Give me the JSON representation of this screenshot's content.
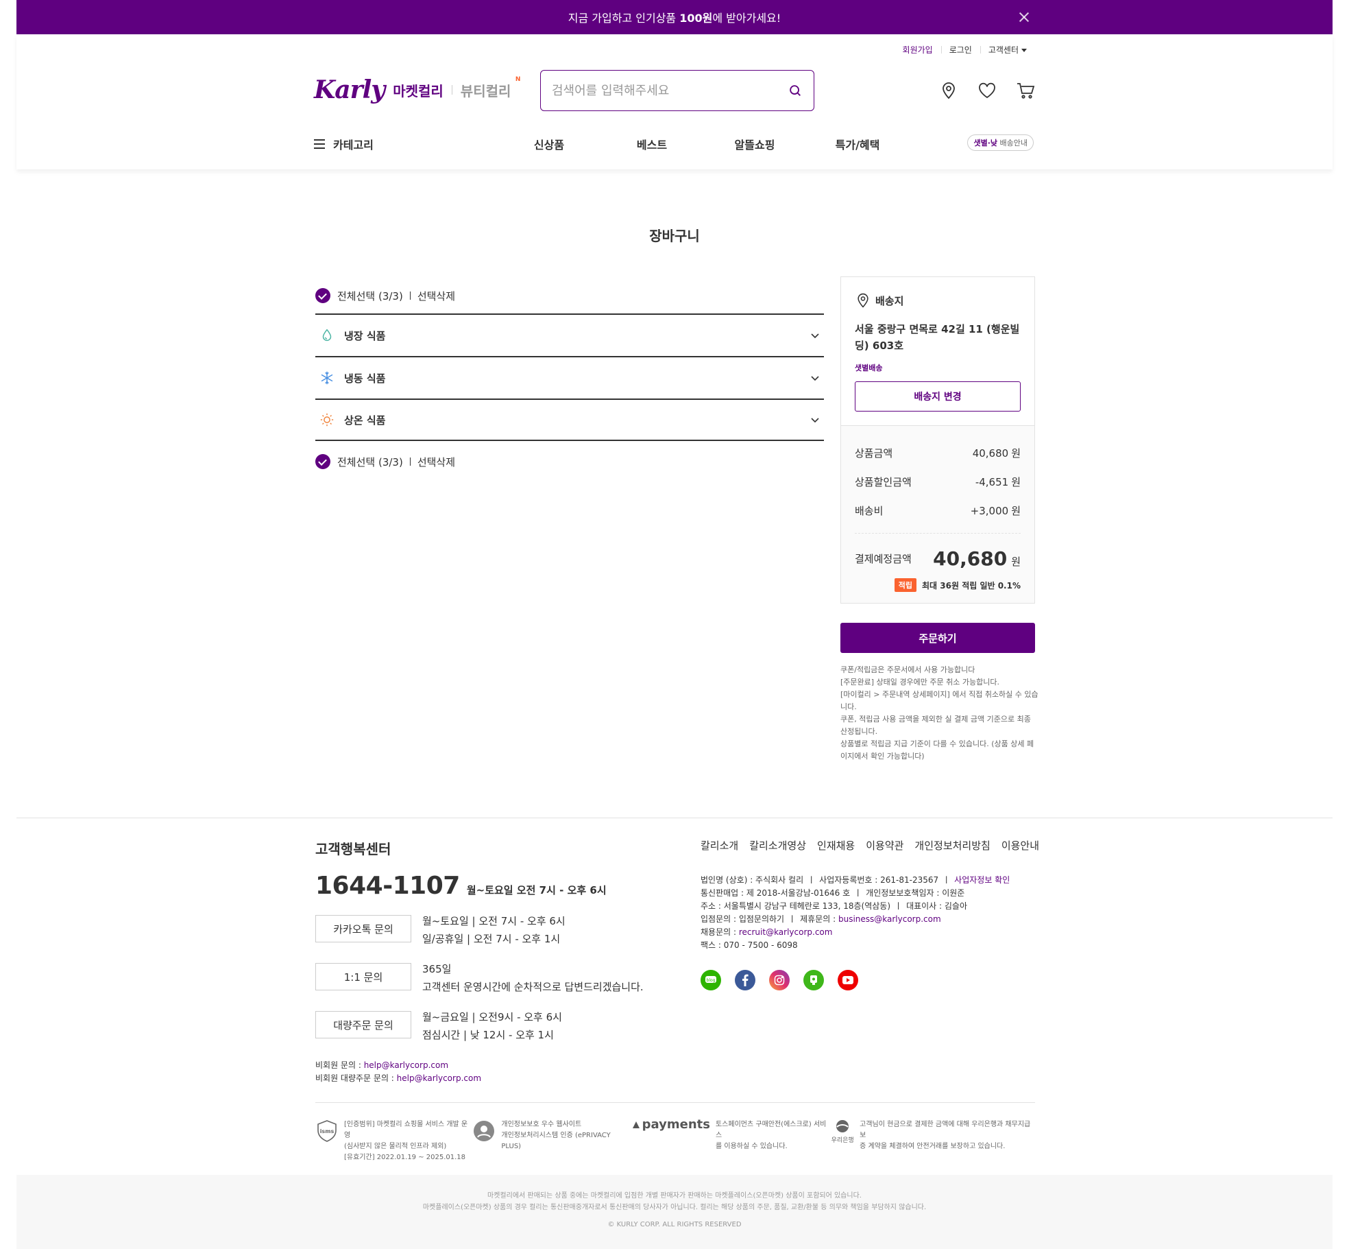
{
  "banner": {
    "text_pre": "지금 가입하고 인기상품 ",
    "text_bold": "100원",
    "text_post": "에 받아가세요!"
  },
  "util": {
    "signup": "회원가입",
    "login": "로그인",
    "support": "고객센터"
  },
  "logo": {
    "karly": "Karly",
    "market": "마켓컬리",
    "beauty": "뷰티컬리",
    "new": "N"
  },
  "search": {
    "placeholder": "검색어를 입력해주세요"
  },
  "gnb": {
    "category": "카테고리",
    "menu": [
      "신상품",
      "베스트",
      "알뜰쇼핑",
      "특가/혜택"
    ],
    "delivery_badge_bold": "샛별·낮",
    "delivery_badge_text": "배송안내"
  },
  "page_title": "장바구니",
  "cart": {
    "select_all": "전체선택 (3/3)",
    "delete_selected": "선택삭제",
    "groups": [
      "냉장 식품",
      "냉동 식품",
      "상온 식품"
    ]
  },
  "address": {
    "title": "배송지",
    "text": "서울 중랑구 면목로 42길 11 (행운빌딩) 603호",
    "type": "샛별배송",
    "change_button": "배송지 변경"
  },
  "price": {
    "rows": [
      {
        "label": "상품금액",
        "value": "40,680",
        "unit": "원"
      },
      {
        "label": "상품할인금액",
        "value": "-4,651",
        "unit": "원"
      },
      {
        "label": "배송비",
        "value": "+3,000",
        "unit": "원"
      }
    ],
    "total_label": "결제예정금액",
    "total_value": "40,680",
    "total_unit": "원",
    "point_tag": "적립",
    "point_text": "최대 36원 적립 일반 0.1%"
  },
  "order_button": "주문하기",
  "notes": [
    "쿠폰/적립금은 주문서에서 사용 가능합니다",
    "[주문완료] 상태일 경우에만 주문 취소 가능합니다.",
    "[마이컬리 > 주문내역 상세페이지] 에서 직접 취소하실 수 있습니다.",
    "쿠폰, 적립금 사용 금액을 제외한 실 결제 금액 기준으로 최종 산정됩니다.",
    "상품별로 적립금 지급 기준이 다를 수 있습니다. (상품 상세 페이지에서 확인 가능합니다)"
  ],
  "footer": {
    "cs_title": "고객행복센터",
    "phone": "1644-1107",
    "phone_hours": "월~토요일 오전 7시 - 오후 6시",
    "channels": [
      {
        "button": "카카오톡 문의",
        "line1": "월~토요일 | 오전 7시 - 오후 6시",
        "line2": "일/공휴일 | 오전 7시 - 오후 1시"
      },
      {
        "button": "1:1 문의",
        "line1": "365일",
        "line2": "고객센터 운영시간에 순차적으로 답변드리겠습니다."
      },
      {
        "button": "대량주문 문의",
        "line1": "월~금요일 | 오전9시 - 오후 6시",
        "line2": "점심시간 | 낮 12시 - 오후 1시"
      }
    ],
    "mail1_label": "비회원 문의 : ",
    "mail1": "help@karlycorp.com",
    "mail2_label": "비회원 대량주문 문의 : ",
    "mail2": "help@karlycorp.com",
    "links": [
      "칼리소개",
      "칼리소개영상",
      "인재채용",
      "이용약관",
      "개인정보처리방침",
      "이용안내"
    ],
    "info": {
      "company": "법인명 (상호) : 주식회사 컬리",
      "biz_no": "사업자등록번호 : 261-81-23567",
      "biz_check": "사업자정보 확인",
      "ecommerce": "통신판매업 : 제 2018-서울강남-01646 호",
      "privacy_officer": "개인정보보호책임자 : 이원준",
      "address": "주소 : 서울특별시 강남구 테헤란로 133, 18층(역삼동)",
      "ceo": "대표이사 : 김슬아",
      "partner": "입점문의 : 입점문의하기",
      "affiliate_label": "제휴문의 : ",
      "affiliate": "business@karlycorp.com",
      "recruit_label": "채용문의 : ",
      "recruit": "recruit@karlycorp.com",
      "fax": "팩스 : 070 - 7500 - 6098"
    },
    "sns": [
      "blog-icon",
      "facebook-icon",
      "instagram-icon",
      "naver-post-icon",
      "youtube-icon"
    ],
    "certs": [
      {
        "logo": "isms",
        "l1": "[인증범위] 마켓컬리 쇼핑몰 서비스 개발 운영",
        "l2": "(심사받지 않은 물리적 인프라 제외)",
        "l3": "[유효기간] 2022.01.19 ~ 2025.01.18"
      },
      {
        "logo": "eprivacy",
        "l1": "개인정보보호 우수 웹사이트",
        "l2": "개인정보처리시스템 인증 (ePRIVACY PLUS)",
        "l3": ""
      },
      {
        "logo": "payments",
        "logo_text": "payments",
        "l1": "토스페이먼츠 구매안전(에스크로) 서비스",
        "l2": "를 이용하실 수 있습니다.",
        "l3": ""
      },
      {
        "logo": "woori",
        "logo_text": "우리은행",
        "l1": "고객님이 현금으로 결제한 금액에 대해 우리은행과 채무지급보",
        "l2": "증 계약을 체결하여 안전거래를 보장하고 있습니다.",
        "l3": ""
      }
    ],
    "bottom1": "마켓컬리에서 판매되는 상품 중에는 마켓컬리에 입점한 개별 판매자가 판매하는 마켓플레이스(오픈마켓) 상품이 포함되어 있습니다.",
    "bottom2": "마켓플레이스(오픈마켓) 상품의 경우 컬리는 통신판매중개자로서 통신판매의 당사자가 아닙니다. 컬리는 해당 상품의 주문, 품질, 교환/환불 등 의무와 책임을 부담하지 않습니다.",
    "copyright": "© KURLY CORP. ALL RIGHTS RESERVED"
  },
  "colors": {
    "brand": "#5f0080",
    "accent": "#fa622f"
  }
}
